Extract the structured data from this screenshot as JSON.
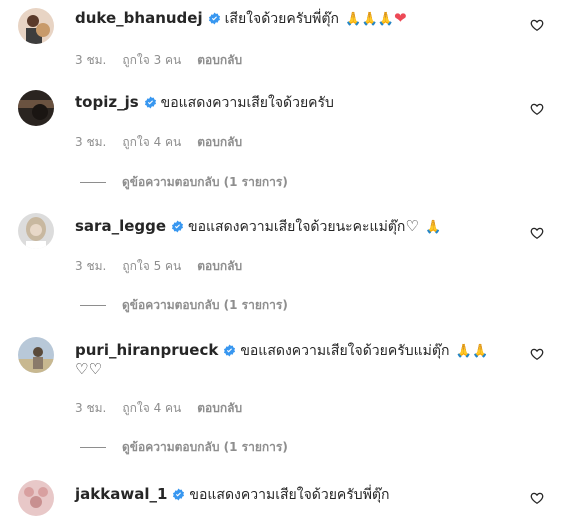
{
  "comments": [
    {
      "username": "duke_bhanudej",
      "text": "เสียใจด้วยครับพี่ตุ๊ก",
      "emojis": "🙏🙏🙏",
      "heart": "❤",
      "time": "3 ชม.",
      "likes": "ถูกใจ 3 คน",
      "reply": "ตอบกลับ"
    },
    {
      "username": "topiz_js",
      "text": "ขอแสดงความเสียใจด้วยครับ",
      "time": "3 ชม.",
      "likes": "ถูกใจ 4 คน",
      "reply": "ตอบกลับ",
      "view_replies": "ดูข้อความตอบกลับ (1 รายการ)"
    },
    {
      "username": "sara_legge",
      "text": "ขอแสดงความเสียใจด้วยนะคะแม่ตุ๊ก",
      "heart": "♡",
      "emojis": "🙏",
      "time": "3 ชม.",
      "likes": "ถูกใจ 5 คน",
      "reply": "ตอบกลับ",
      "view_replies": "ดูข้อความตอบกลับ (1 รายการ)"
    },
    {
      "username": "puri_hiranprueck",
      "text": "ขอแสดงความเสียใจด้วยครับแม่ตุ๊ก",
      "emojis": "🙏🙏",
      "second_line": "♡♡",
      "time": "3 ชม.",
      "likes": "ถูกใจ 4 คน",
      "reply": "ตอบกลับ",
      "view_replies": "ดูข้อความตอบกลับ (1 รายการ)"
    },
    {
      "username": "jakkawal_1",
      "text": "ขอแสดงความเสียใจด้วยครับพี่ตุ๊ก"
    }
  ],
  "colors": {
    "verified": "#3897f0",
    "meta": "#8e8e8e",
    "heart_red": "#ed4956"
  },
  "icons": {
    "like": "heart-outline-icon",
    "verified": "verified-badge-icon"
  }
}
